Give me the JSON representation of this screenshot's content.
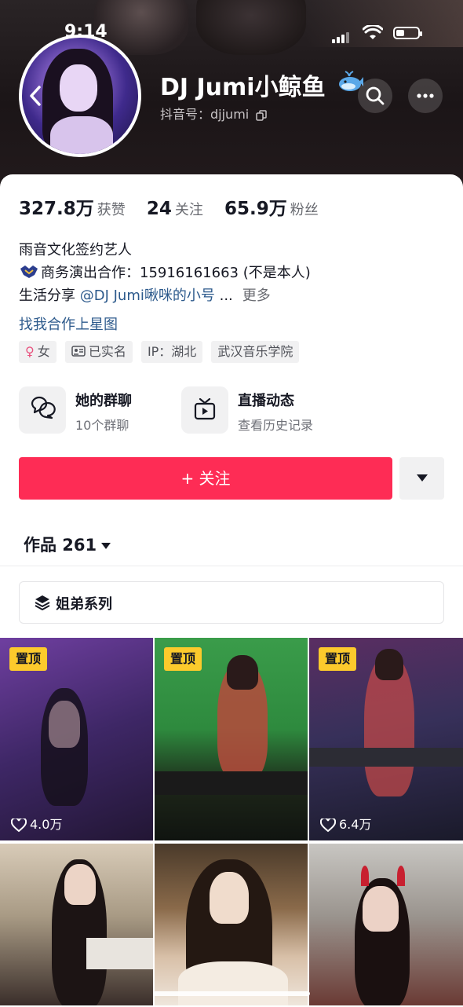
{
  "status_bar": {
    "time": "9:14"
  },
  "profile": {
    "name": "DJ Jumi小鲸鱼",
    "douyin_id": "抖音号：djjumi",
    "stats": [
      {
        "value": "327.8万",
        "label": "获赞"
      },
      {
        "value": "24",
        "label": "关注"
      },
      {
        "value": "65.9万",
        "label": "粉丝"
      }
    ],
    "bio": {
      "line1": "雨音文化签约艺人",
      "line2": "商务演出合作：15916161663 (不是本人)",
      "line3_prefix": "生活分享 ",
      "line3_link": "@DJ Jumi啾咪的小号",
      "line3_ellipsis": " ...",
      "more": "更多"
    },
    "collab_link": "找我合作上星图",
    "tags": [
      "女",
      "已实名",
      "IP：湖北",
      "武汉音乐学院"
    ]
  },
  "entries": {
    "group": {
      "title": "她的群聊",
      "subtitle": "10个群聊"
    },
    "live": {
      "title": "直播动态",
      "subtitle": "查看历史记录"
    }
  },
  "actions": {
    "follow": "+ 关注"
  },
  "works": {
    "label": "作品 261",
    "series": "姐弟系列"
  },
  "videos": [
    {
      "pinned": "置顶",
      "likes": "4.0万"
    },
    {
      "pinned": "置顶",
      "likes": ""
    },
    {
      "pinned": "置顶",
      "likes": "6.4万"
    }
  ],
  "colors": {
    "accent": "#fe2c55",
    "pin_badge": "#fcca2c",
    "link": "#2d5a8c"
  }
}
